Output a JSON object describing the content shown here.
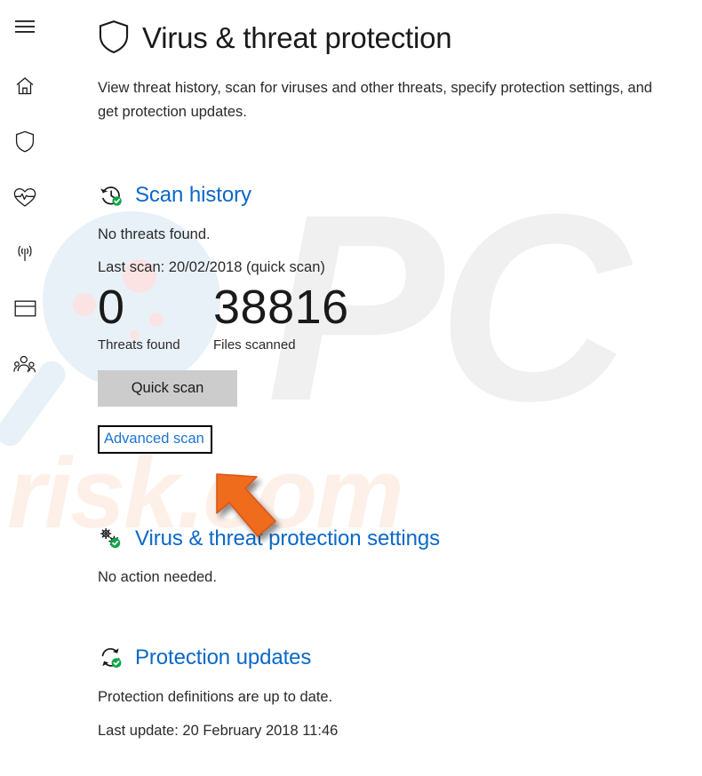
{
  "sidebar": {
    "items": [
      {
        "name": "menu",
        "icon": "hamburger-menu-icon",
        "label": "Menu"
      },
      {
        "name": "home",
        "icon": "home-icon",
        "label": "Home"
      },
      {
        "name": "virus-threat",
        "icon": "shield-icon",
        "label": "Virus & threat protection"
      },
      {
        "name": "device-health",
        "icon": "heart-pulse-icon",
        "label": "Device performance & health"
      },
      {
        "name": "firewall",
        "icon": "signal-tower-icon",
        "label": "Firewall & network protection"
      },
      {
        "name": "app-browser",
        "icon": "browser-window-icon",
        "label": "App & browser control"
      },
      {
        "name": "family-options",
        "icon": "family-people-icon",
        "label": "Family options"
      }
    ]
  },
  "header": {
    "icon": "shield-icon",
    "title": "Virus & threat protection",
    "description": "View threat history, scan for viruses and other threats, specify protection settings, and get protection updates."
  },
  "scan_history": {
    "icon": "history-clock-check-icon",
    "title": "Scan history",
    "status": "No threats found.",
    "last_scan": "Last scan: 20/02/2018 (quick scan)",
    "stats": [
      {
        "value": "0",
        "label": "Threats found"
      },
      {
        "value": "38816",
        "label": "Files scanned"
      }
    ],
    "quick_scan_button": "Quick scan",
    "advanced_scan_link": "Advanced scan"
  },
  "vt_settings": {
    "icon": "gears-check-icon",
    "title": "Virus & threat protection settings",
    "status": "No action needed."
  },
  "protection_updates": {
    "icon": "refresh-check-icon",
    "title": "Protection updates",
    "status": "Protection definitions are up to date.",
    "last_update": "Last update: 20 February 2018 11:46"
  },
  "annotations": {
    "highlight_target": "Advanced scan",
    "highlight_box_color": "#000000",
    "arrow_color": "#ef6c1f",
    "arrow_points_to": "advanced-scan-link"
  },
  "watermarks": {
    "primary": "PC",
    "secondary": "risk.com",
    "glass_color": "#e8f1f8",
    "pc_color": "#f0f0f0",
    "risk_color": "#fdf0e8"
  },
  "colors": {
    "link_blue": "#0c68c7",
    "accent_orange": "#ef6c1f",
    "check_green": "#10a44a",
    "button_gray": "#cccccc",
    "text": "#2a2a2a",
    "background": "#ffffff"
  }
}
